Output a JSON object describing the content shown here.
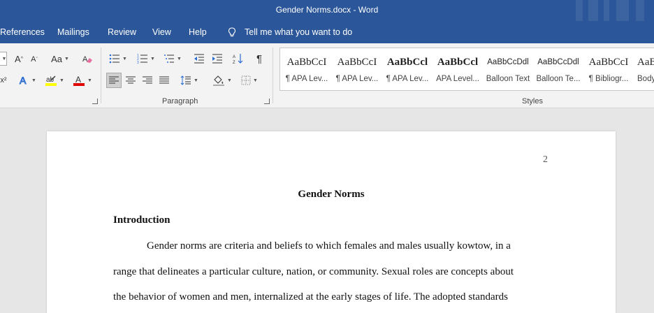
{
  "window": {
    "title": "Gender Norms.docx  -  Word"
  },
  "tabs": [
    "References",
    "Mailings",
    "Review",
    "View",
    "Help"
  ],
  "tell_me": "Tell me what you want to do",
  "ribbon": {
    "font_group": {
      "change_case": "Aa",
      "grow": "A",
      "shrink": "A"
    },
    "paragraph_label": "Paragraph",
    "styles_label": "Styles",
    "styles": [
      {
        "sample": "AaBbCcI",
        "name": "¶ APA Lev..."
      },
      {
        "sample": "AaBbCcI",
        "name": "¶ APA Lev..."
      },
      {
        "sample": "AaBbCcl",
        "name": "¶ APA Lev..."
      },
      {
        "sample": "AaBbCcl",
        "name": "APA Level..."
      },
      {
        "sample": "AaBbCcDdl",
        "name": "Balloon Text"
      },
      {
        "sample": "AaBbCcDdl",
        "name": "Balloon Te..."
      },
      {
        "sample": "AaBbCcI",
        "name": "¶ Bibliogr..."
      },
      {
        "sample": "AaB",
        "name": "Body"
      }
    ]
  },
  "document": {
    "page_number": "2",
    "title": "Gender Norms",
    "heading": "Introduction",
    "lines": [
      "Gender norms are criteria and beliefs to which females and males usually kowtow, in a",
      "range that delineates a particular culture, nation, or community. Sexual roles are concepts about",
      "the behavior of women and men, internalized at the early stages of life. The adopted standards"
    ]
  },
  "colors": {
    "word_blue": "#2b579a",
    "highlight": "#ffff00",
    "font_red": "#e00000"
  }
}
